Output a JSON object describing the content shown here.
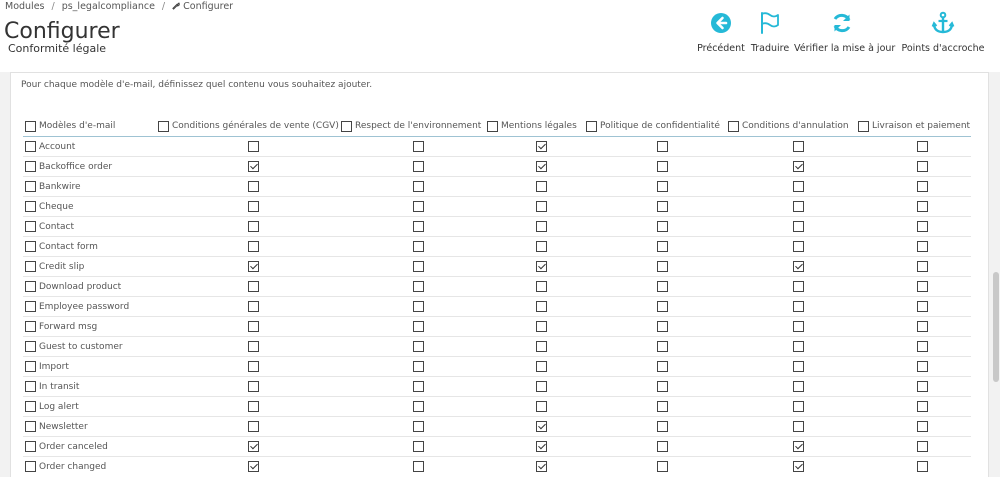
{
  "breadcrumb": [
    "Modules",
    "ps_legalcompliance",
    "Configurer"
  ],
  "header": {
    "title": "Configurer",
    "subtitle": "Conformité légale"
  },
  "toolbar": [
    {
      "label": "Précédent",
      "icon": "arrow-left-circle-icon"
    },
    {
      "label": "Traduire",
      "icon": "flag-icon"
    },
    {
      "label": "Vérifier la mise à jour",
      "icon": "refresh-icon"
    },
    {
      "label": "Points d'accroche",
      "icon": "anchor-icon"
    }
  ],
  "colors": {
    "accent": "#25b9d7",
    "text": "#555555",
    "header_bg": "#ffffff",
    "page_bg": "#f2f2f2"
  },
  "intro": "Pour chaque modèle d'e-mail, définissez quel contenu vous souhaitez ajouter.",
  "table": {
    "name_header": "Modèles d'e-mail",
    "columns": [
      "Conditions générales de vente (CGV)",
      "Respect de l'environnement",
      "Mentions légales",
      "Politique de confidentialité",
      "Conditions d'annulation",
      "Livraison et paiement"
    ],
    "rows": [
      {
        "name": "Account",
        "checks": [
          false,
          false,
          true,
          false,
          false,
          false
        ]
      },
      {
        "name": "Backoffice order",
        "checks": [
          true,
          false,
          true,
          false,
          true,
          false
        ]
      },
      {
        "name": "Bankwire",
        "checks": [
          false,
          false,
          false,
          false,
          false,
          false
        ]
      },
      {
        "name": "Cheque",
        "checks": [
          false,
          false,
          false,
          false,
          false,
          false
        ]
      },
      {
        "name": "Contact",
        "checks": [
          false,
          false,
          false,
          false,
          false,
          false
        ]
      },
      {
        "name": "Contact form",
        "checks": [
          false,
          false,
          false,
          false,
          false,
          false
        ]
      },
      {
        "name": "Credit slip",
        "checks": [
          true,
          false,
          true,
          false,
          true,
          false
        ]
      },
      {
        "name": "Download product",
        "checks": [
          false,
          false,
          false,
          false,
          false,
          false
        ]
      },
      {
        "name": "Employee password",
        "checks": [
          false,
          false,
          false,
          false,
          false,
          false
        ]
      },
      {
        "name": "Forward msg",
        "checks": [
          false,
          false,
          false,
          false,
          false,
          false
        ]
      },
      {
        "name": "Guest to customer",
        "checks": [
          false,
          false,
          false,
          false,
          false,
          false
        ]
      },
      {
        "name": "Import",
        "checks": [
          false,
          false,
          false,
          false,
          false,
          false
        ]
      },
      {
        "name": "In transit",
        "checks": [
          false,
          false,
          false,
          false,
          false,
          false
        ]
      },
      {
        "name": "Log alert",
        "checks": [
          false,
          false,
          false,
          false,
          false,
          false
        ]
      },
      {
        "name": "Newsletter",
        "checks": [
          false,
          false,
          true,
          false,
          false,
          false
        ]
      },
      {
        "name": "Order canceled",
        "checks": [
          true,
          false,
          true,
          false,
          true,
          false
        ]
      },
      {
        "name": "Order changed",
        "checks": [
          true,
          false,
          true,
          false,
          true,
          false
        ]
      }
    ]
  }
}
